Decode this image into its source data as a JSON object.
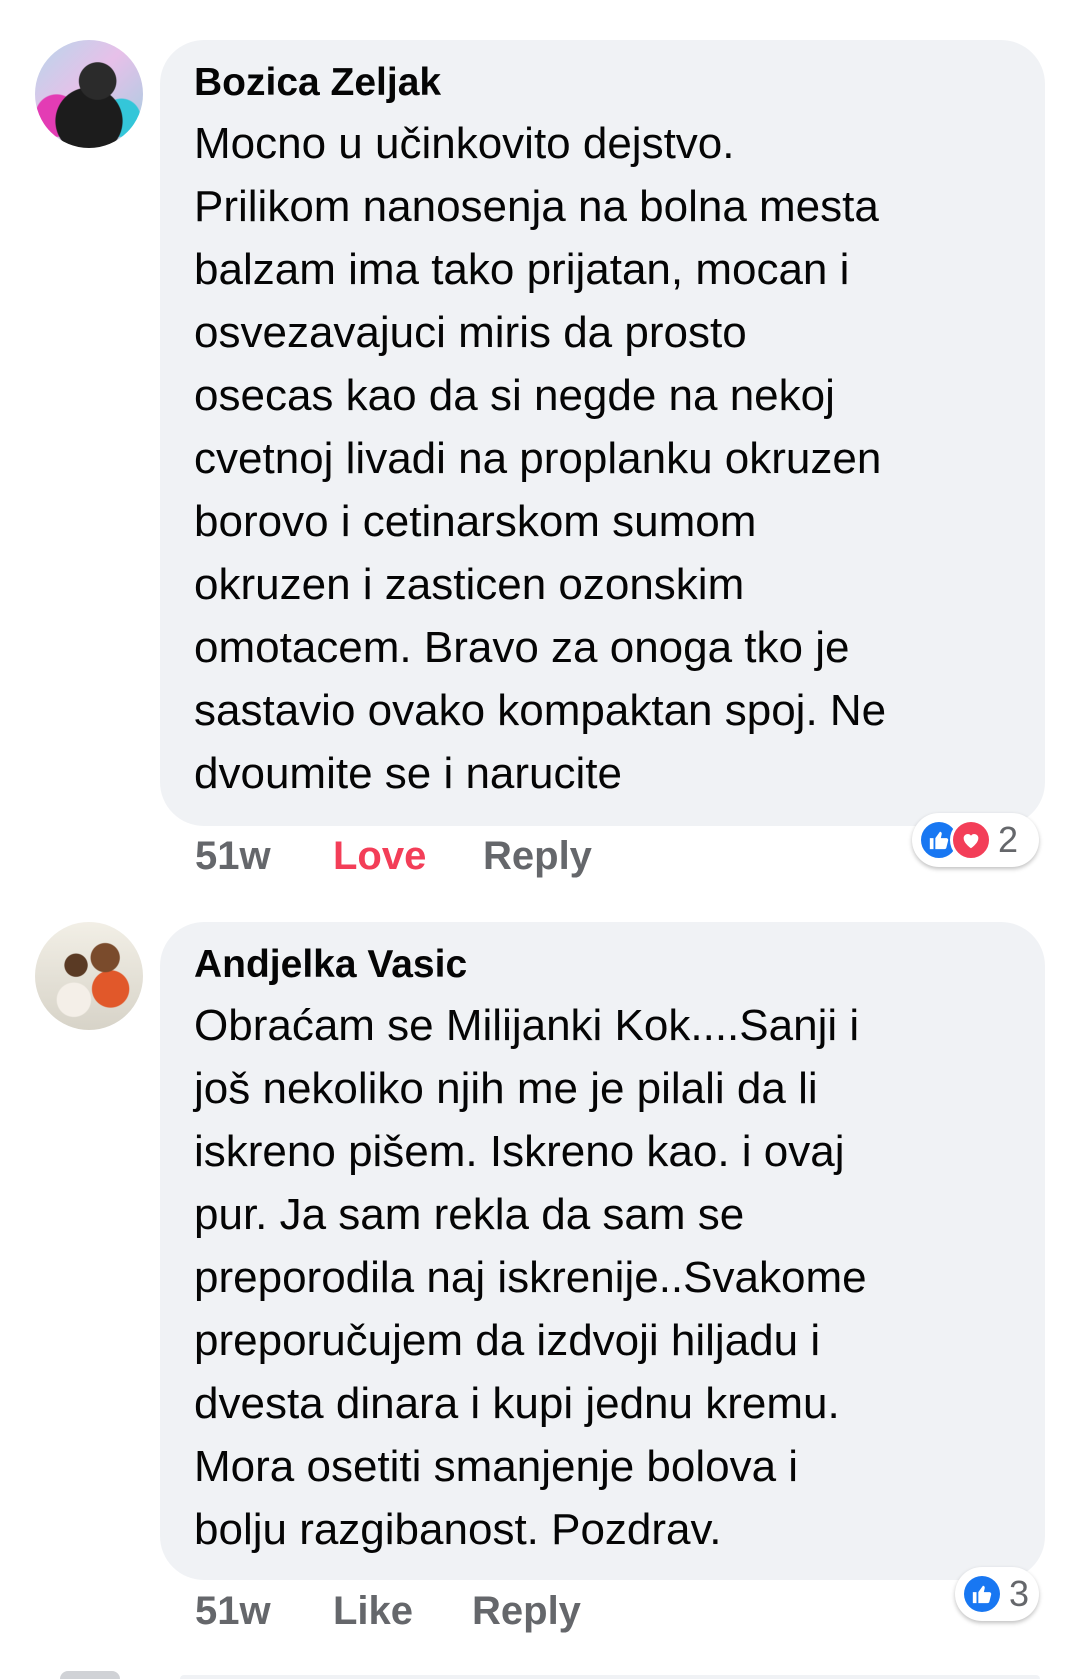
{
  "comments": [
    {
      "author": "Bozica Zeljak",
      "text": "Mocno u učinkovito dejstvo.\nPrilikom nanosenja na bolna mesta\nbalzam ima tako prijatan, mocan i\nosvezavajuci miris da prosto\nosecas kao da si negde na nekoj\ncvetnoj livadi na proplanku okruzen\nborovo i cetinarskom sumom\nokruzen i zasticen ozonskim\nomotacem. Bravo za onoga tko je\nsastavio ovako kompaktan spoj. Ne\ndvoumite se i narucite",
      "time": "51w",
      "reaction_action": "Love",
      "reaction_action_color": "#f33e58",
      "reply_label": "Reply",
      "reaction_count": "2",
      "reaction_icons": [
        "like-icon",
        "heart-icon"
      ]
    },
    {
      "author": "Andjelka Vasic",
      "text": "Obraćam se Milijanki Kok....Sanji i\njoš nekoliko njih me je pilali da li\niskreno pišem. Iskreno kao. i ovaj\npur. Ja sam rekla da sam se\npreporodila naj iskrenije..Svakome\npreporučujem da izdvoji hiljadu i\ndvesta dinara i kupi jednu kremu.\nMora osetiti smanjenje bolova i\nbolju razgibanost. Pozdrav.",
      "time": "51w",
      "reaction_action": "Like",
      "reaction_action_color": "#65676b",
      "reply_label": "Reply",
      "reaction_count": "3",
      "reaction_icons": [
        "like-icon"
      ]
    }
  ]
}
